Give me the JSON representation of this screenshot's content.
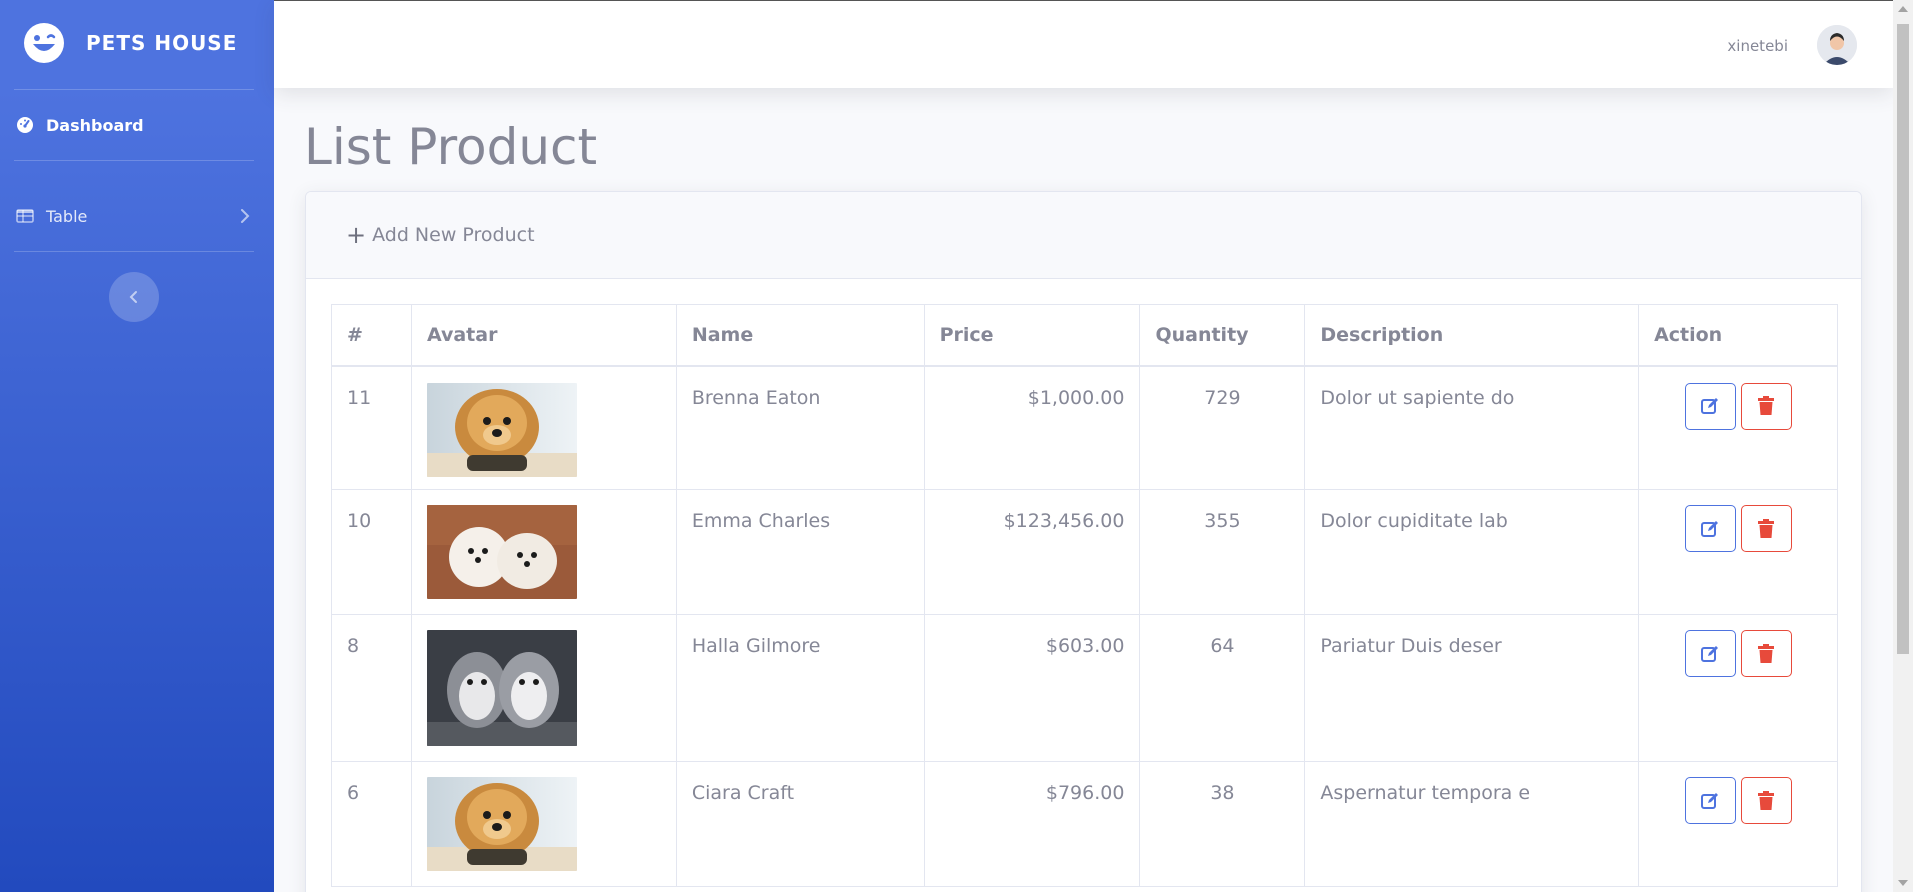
{
  "brand": {
    "name": "PETS HOUSE"
  },
  "sidebar": {
    "items": [
      {
        "label": "Dashboard",
        "icon": "tachometer-icon"
      },
      {
        "label": "Table",
        "icon": "table-icon"
      }
    ],
    "toggle_icon": "chevron-left-icon"
  },
  "topbar": {
    "user_name": "xinetebi"
  },
  "page": {
    "title": "List Product"
  },
  "toolbar": {
    "add_label": "Add New Product",
    "add_icon": "plus-icon"
  },
  "table": {
    "columns": [
      "#",
      "Avatar",
      "Name",
      "Price",
      "Quantity",
      "Description",
      "Action"
    ],
    "rows": [
      {
        "id": "11",
        "avatar": "fluffy-pomeranian",
        "name": "Brenna Eaton",
        "price": "$1,000.00",
        "quantity": "729",
        "description": "Dolor ut sapiente do"
      },
      {
        "id": "10",
        "avatar": "two-white-puppies",
        "name": "Emma Charles",
        "price": "$123,456.00",
        "quantity": "355",
        "description": "Dolor cupiditate lab"
      },
      {
        "id": "8",
        "avatar": "two-husky-puppies",
        "name": "Halla Gilmore",
        "price": "$603.00",
        "quantity": "64",
        "description": "Pariatur Duis deser"
      },
      {
        "id": "6",
        "avatar": "fluffy-pomeranian",
        "name": "Ciara Craft",
        "price": "$796.00",
        "quantity": "38",
        "description": "Aspernatur tempora e"
      }
    ]
  },
  "colors": {
    "primary": "#4e73df",
    "danger": "#e74a3b",
    "text": "#858796"
  }
}
